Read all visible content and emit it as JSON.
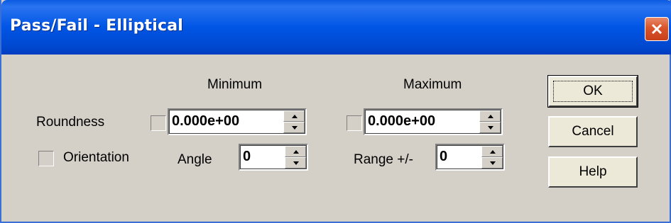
{
  "window": {
    "title": "Pass/Fail - Elliptical",
    "close_label": "close"
  },
  "headers": {
    "minimum": "Minimum",
    "maximum": "Maximum"
  },
  "roundness": {
    "label": "Roundness",
    "min_checked": false,
    "min_value": "0.000e+00",
    "max_checked": false,
    "max_value": "0.000e+00"
  },
  "orientation": {
    "label": "Orientation",
    "checked": false,
    "angle_label": "Angle",
    "angle_value": "0",
    "range_label": "Range +/-",
    "range_value": "0"
  },
  "buttons": {
    "ok": "OK",
    "cancel": "Cancel",
    "help": "Help"
  },
  "colors": {
    "titlebar": "#0055e5",
    "dialog_bg": "#d4d0c8",
    "close_button": "#d9542a"
  }
}
